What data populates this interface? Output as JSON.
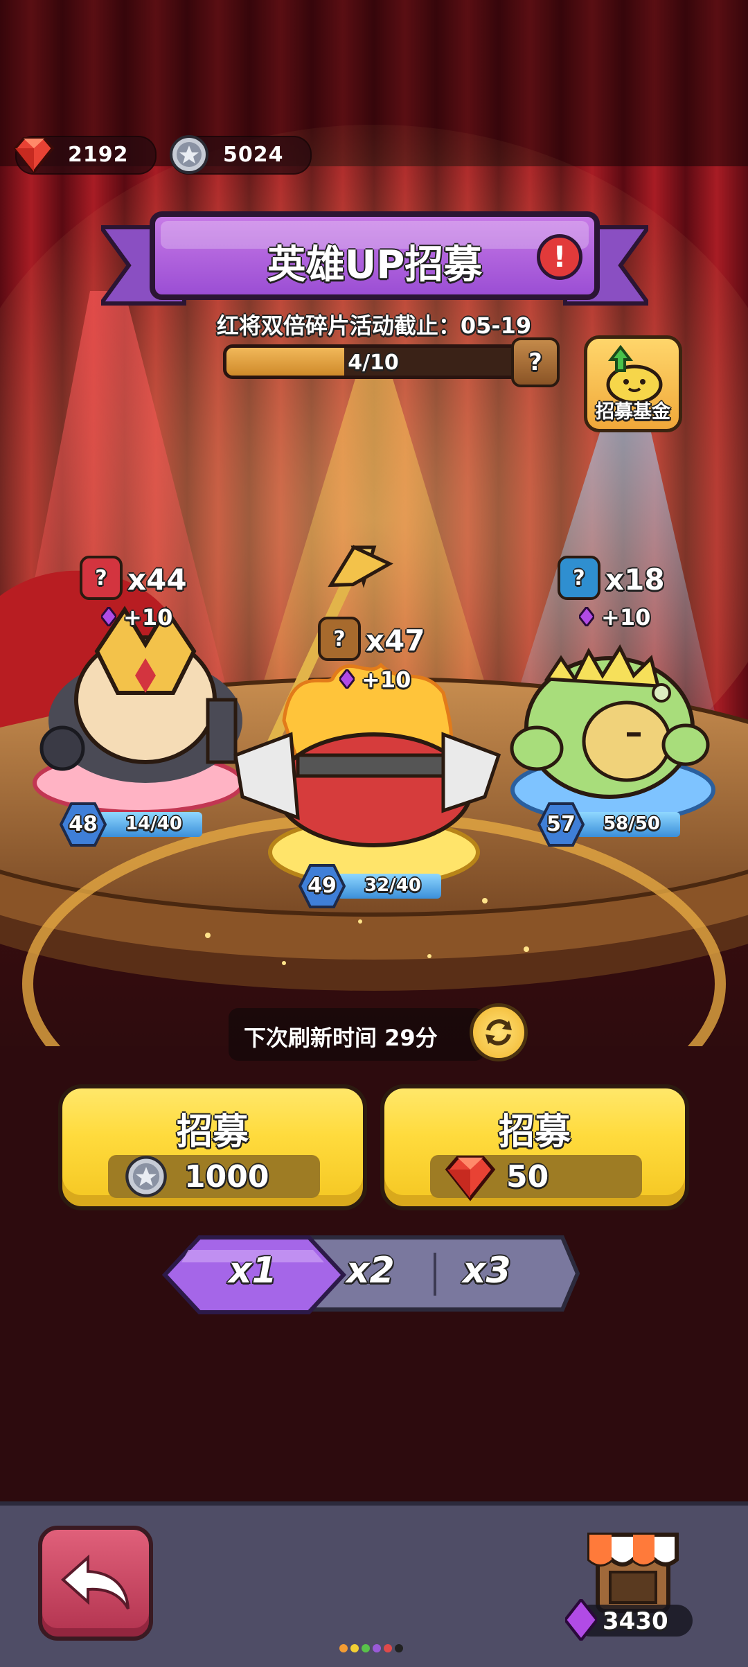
{
  "currencies": {
    "ruby": "2192",
    "silver": "5024"
  },
  "banner": {
    "title": "英雄UP招募",
    "alert": "!",
    "event_text": "红将双倍碎片活动截止：05-19",
    "progress_text": "4/10",
    "progress_value": 0.4,
    "progress_box": "?"
  },
  "fund_button": {
    "label": "招募基金"
  },
  "heroes": [
    {
      "badge": "?",
      "count": "x44",
      "bonus": "+10",
      "level": "48",
      "shards": "14/40",
      "color": "#d3343f"
    },
    {
      "badge": "?",
      "count": "x47",
      "bonus": "+10",
      "level": "49",
      "shards": "32/40",
      "color": "#a76a2d"
    },
    {
      "badge": "?",
      "count": "x18",
      "bonus": "+10",
      "level": "57",
      "shards": "58/50",
      "color": "#2f8fd0"
    }
  ],
  "refresh": {
    "text": "下次刷新时间 29分"
  },
  "recruit_buttons": [
    {
      "label": "招募",
      "cost": "1000",
      "currency": "silver-coin-icon"
    },
    {
      "label": "招募",
      "cost": "50",
      "currency": "ruby-gem-icon"
    }
  ],
  "multipliers": {
    "options": [
      "x1",
      "x2",
      "x3"
    ],
    "selected": "x1"
  },
  "bottom": {
    "shop_gems": "3430"
  },
  "colors": {
    "accent_purple": "#9b4ed4",
    "button_yellow": "#ffdb3d",
    "back_button": "#c83a56",
    "bottom_bar": "#4f4d66"
  }
}
